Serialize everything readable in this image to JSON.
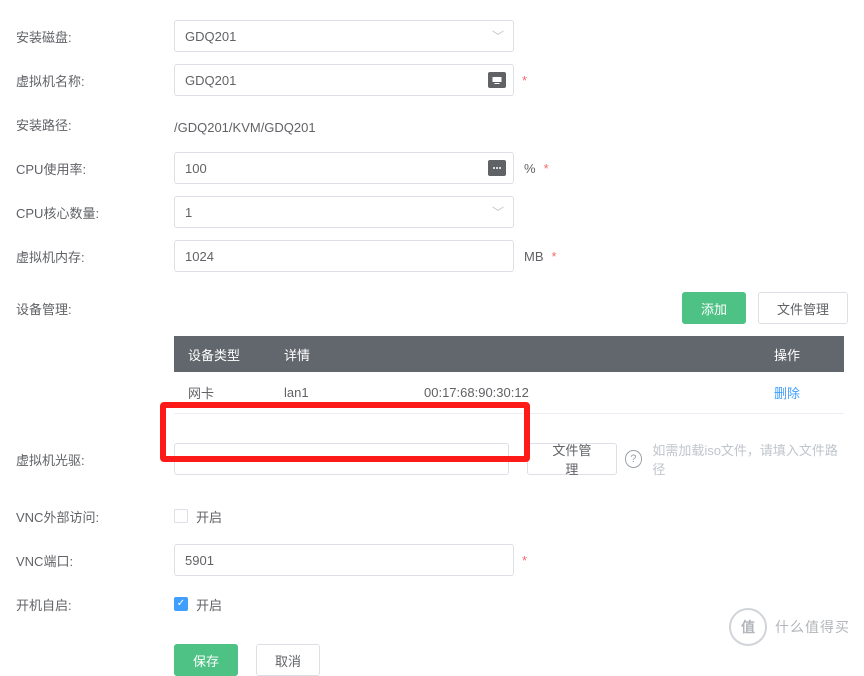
{
  "labels": {
    "install_disk": "安装磁盘:",
    "vm_name": "虚拟机名称:",
    "install_path": "安装路径:",
    "cpu_usage": "CPU使用率:",
    "cpu_cores": "CPU核心数量:",
    "vm_memory": "虚拟机内存:",
    "device_mgmt": "设备管理:",
    "vm_cdrom": "虚拟机光驱:",
    "vnc_external": "VNC外部访问:",
    "vnc_port": "VNC端口:",
    "boot_auto": "开机自启:"
  },
  "values": {
    "install_disk": "GDQ201",
    "vm_name": "GDQ201",
    "install_path": "/GDQ201/KVM/GDQ201",
    "cpu_usage": "100",
    "cpu_cores": "1",
    "vm_memory": "1024",
    "vm_cdrom": "",
    "vnc_port": "5901"
  },
  "units": {
    "percent": "%",
    "mb": "MB"
  },
  "buttons": {
    "add": "添加",
    "file_mgmt": "文件管理",
    "save": "保存",
    "cancel": "取消",
    "delete": "删除"
  },
  "table": {
    "headers": {
      "type": "设备类型",
      "detail": "详情",
      "action": "操作"
    },
    "rows": [
      {
        "type": "网卡",
        "detail": "lan1",
        "mac": "00:17:68:90:30:12"
      }
    ]
  },
  "checkbox": {
    "open": "开启"
  },
  "hints": {
    "iso": "如需加载iso文件，请填入文件路径"
  },
  "star": "*",
  "watermark": {
    "circle": "值",
    "text": "什么值得买"
  }
}
